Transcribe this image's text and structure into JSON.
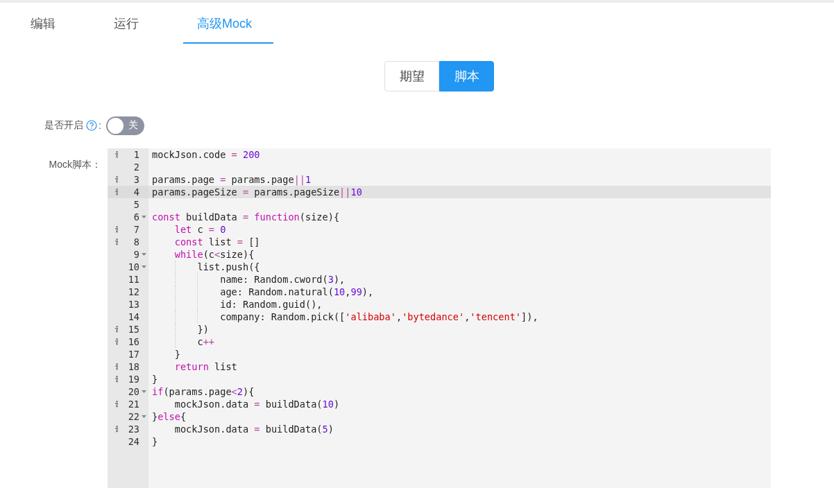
{
  "tabs": [
    {
      "label": "编辑",
      "selected": false
    },
    {
      "label": "运行",
      "selected": false
    },
    {
      "label": "高级Mock",
      "selected": true
    }
  ],
  "mode_switch": [
    {
      "label": "期望",
      "selected": false
    },
    {
      "label": "脚本",
      "selected": true
    }
  ],
  "enable": {
    "label": "是否开启",
    "suffix": ":",
    "on": false,
    "text": "关"
  },
  "script_label": "Mock脚本：",
  "editor": {
    "lines": [
      {
        "number": "1",
        "info": true,
        "foldable": false,
        "highlighted": false,
        "tokens": [
          {
            "kind": "plain",
            "text": "mockJson.code"
          },
          {
            "kind": "operator",
            "text": " = "
          },
          {
            "kind": "number",
            "text": "200"
          }
        ]
      },
      {
        "number": "2",
        "info": false,
        "foldable": false,
        "highlighted": false
      },
      {
        "number": "3",
        "info": true,
        "foldable": false,
        "highlighted": false,
        "tokens": [
          {
            "kind": "plain",
            "text": "params.page"
          },
          {
            "kind": "operator",
            "text": " = "
          },
          {
            "kind": "plain",
            "text": "params.page"
          },
          {
            "kind": "operator",
            "text": "||"
          },
          {
            "kind": "number",
            "text": "1"
          }
        ]
      },
      {
        "number": "4",
        "info": true,
        "foldable": false,
        "highlighted": true,
        "tokens": [
          {
            "kind": "plain",
            "text": "params.pageSize"
          },
          {
            "kind": "operator",
            "text": " = "
          },
          {
            "kind": "plain",
            "text": "params.pageSize"
          },
          {
            "kind": "operator",
            "text": "||"
          },
          {
            "kind": "number",
            "text": "10"
          }
        ]
      },
      {
        "number": "5",
        "info": false,
        "foldable": false,
        "highlighted": false
      },
      {
        "number": "6",
        "info": false,
        "foldable": true,
        "highlighted": false,
        "tokens": [
          {
            "kind": "keyword",
            "text": "const"
          },
          {
            "kind": "plain",
            "text": " buildData"
          },
          {
            "kind": "operator",
            "text": " = "
          },
          {
            "kind": "keyword",
            "text": "function"
          },
          {
            "kind": "plain",
            "text": "(size){"
          }
        ]
      },
      {
        "number": "7",
        "info": true,
        "foldable": false,
        "highlighted": false,
        "tokens": [
          {
            "kind": "keyword",
            "text": "    let"
          },
          {
            "kind": "plain",
            "text": " c"
          },
          {
            "kind": "operator",
            "text": " = "
          },
          {
            "kind": "number",
            "text": "0"
          }
        ]
      },
      {
        "number": "8",
        "info": true,
        "foldable": false,
        "highlighted": false,
        "tokens": [
          {
            "kind": "keyword",
            "text": "    const"
          },
          {
            "kind": "plain",
            "text": " list"
          },
          {
            "kind": "operator",
            "text": " = "
          },
          {
            "kind": "plain",
            "text": "[]"
          }
        ]
      },
      {
        "number": "9",
        "info": false,
        "foldable": true,
        "highlighted": false,
        "tokens": [
          {
            "kind": "keyword",
            "text": "    while"
          },
          {
            "kind": "plain",
            "text": "(c"
          },
          {
            "kind": "operator",
            "text": "<"
          },
          {
            "kind": "plain",
            "text": "size){"
          }
        ]
      },
      {
        "number": "10",
        "info": false,
        "foldable": true,
        "highlighted": false,
        "tokens": [
          {
            "kind": "plain",
            "text": "        list.push({"
          }
        ]
      },
      {
        "number": "11",
        "info": false,
        "foldable": false,
        "highlighted": false,
        "tokens": [
          {
            "kind": "plain",
            "text": "            name: Random.cword("
          },
          {
            "kind": "number",
            "text": "3"
          },
          {
            "kind": "plain",
            "text": "),"
          }
        ]
      },
      {
        "number": "12",
        "info": false,
        "foldable": false,
        "highlighted": false,
        "tokens": [
          {
            "kind": "plain",
            "text": "            age: Random.natural("
          },
          {
            "kind": "number",
            "text": "10"
          },
          {
            "kind": "plain",
            "text": ","
          },
          {
            "kind": "number",
            "text": "99"
          },
          {
            "kind": "plain",
            "text": "),"
          }
        ]
      },
      {
        "number": "13",
        "info": false,
        "foldable": false,
        "highlighted": false,
        "tokens": [
          {
            "kind": "plain",
            "text": "            id: Random.guid(),"
          }
        ]
      },
      {
        "number": "14",
        "info": false,
        "foldable": false,
        "highlighted": false,
        "tokens": [
          {
            "kind": "plain",
            "text": "            company: Random.pick(["
          },
          {
            "kind": "string",
            "text": "'alibaba'"
          },
          {
            "kind": "plain",
            "text": ","
          },
          {
            "kind": "string",
            "text": "'bytedance'"
          },
          {
            "kind": "plain",
            "text": ","
          },
          {
            "kind": "string",
            "text": "'tencent'"
          },
          {
            "kind": "plain",
            "text": "]),"
          }
        ]
      },
      {
        "number": "15",
        "info": true,
        "foldable": false,
        "highlighted": false,
        "tokens": [
          {
            "kind": "plain",
            "text": "        })"
          }
        ]
      },
      {
        "number": "16",
        "info": true,
        "foldable": false,
        "highlighted": false,
        "tokens": [
          {
            "kind": "plain",
            "text": "        c"
          },
          {
            "kind": "operator",
            "text": "++"
          }
        ]
      },
      {
        "number": "17",
        "info": false,
        "foldable": false,
        "highlighted": false,
        "tokens": [
          {
            "kind": "plain",
            "text": "    }"
          }
        ]
      },
      {
        "number": "18",
        "info": true,
        "foldable": false,
        "highlighted": false,
        "tokens": [
          {
            "kind": "keyword",
            "text": "    return"
          },
          {
            "kind": "plain",
            "text": " list"
          }
        ]
      },
      {
        "number": "19",
        "info": true,
        "foldable": false,
        "highlighted": false,
        "tokens": [
          {
            "kind": "plain",
            "text": "}"
          }
        ]
      },
      {
        "number": "20",
        "info": false,
        "foldable": true,
        "highlighted": false,
        "tokens": [
          {
            "kind": "keyword",
            "text": "if"
          },
          {
            "kind": "plain",
            "text": "(params.page"
          },
          {
            "kind": "operator",
            "text": "<"
          },
          {
            "kind": "number",
            "text": "2"
          },
          {
            "kind": "plain",
            "text": "){"
          }
        ]
      },
      {
        "number": "21",
        "info": true,
        "foldable": false,
        "highlighted": false,
        "tokens": [
          {
            "kind": "plain",
            "text": "    mockJson.data"
          },
          {
            "kind": "operator",
            "text": " = "
          },
          {
            "kind": "plain",
            "text": "buildData("
          },
          {
            "kind": "number",
            "text": "10"
          },
          {
            "kind": "plain",
            "text": ")"
          }
        ]
      },
      {
        "number": "22",
        "info": false,
        "foldable": true,
        "highlighted": false,
        "tokens": [
          {
            "kind": "plain",
            "text": "}"
          },
          {
            "kind": "keyword",
            "text": "else"
          },
          {
            "kind": "plain",
            "text": "{"
          }
        ]
      },
      {
        "number": "23",
        "info": true,
        "foldable": false,
        "highlighted": false,
        "tokens": [
          {
            "kind": "plain",
            "text": "    mockJson.data"
          },
          {
            "kind": "operator",
            "text": " = "
          },
          {
            "kind": "plain",
            "text": "buildData("
          },
          {
            "kind": "number",
            "text": "5"
          },
          {
            "kind": "plain",
            "text": ")"
          }
        ]
      },
      {
        "number": "24",
        "info": false,
        "foldable": false,
        "highlighted": false,
        "tokens": [
          {
            "kind": "plain",
            "text": "}"
          }
        ]
      }
    ]
  }
}
